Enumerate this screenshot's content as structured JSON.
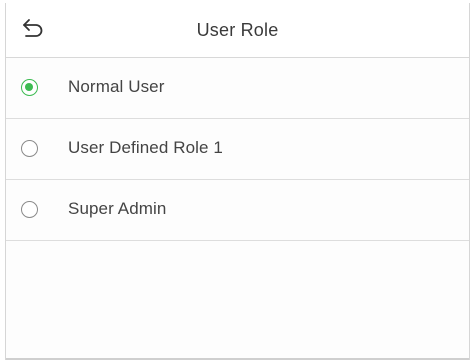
{
  "header": {
    "title": "User Role",
    "back_icon": "back-arrow-icon"
  },
  "options": [
    {
      "label": "Normal User",
      "selected": true
    },
    {
      "label": "User Defined Role 1",
      "selected": false
    },
    {
      "label": "Super Admin",
      "selected": false
    }
  ],
  "colors": {
    "accent": "#3dbb52",
    "radio_border": "#8a8a8a",
    "text": "#444444"
  }
}
